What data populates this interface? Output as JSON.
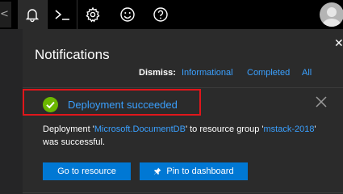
{
  "topbar": {
    "left_stub_glyph": "<",
    "icons": [
      "bell-icon",
      "cloud-shell-icon",
      "gear-icon",
      "smiley-icon",
      "help-icon"
    ],
    "avatar": "user-avatar"
  },
  "panel": {
    "title": "Notifications",
    "close_glyph": "✕",
    "dismiss": {
      "label": "Dismiss:",
      "informational": "Informational",
      "completed": "Completed",
      "all": "All"
    }
  },
  "notification": {
    "title": "Deployment succeeded",
    "body_prefix": "Deployment '",
    "resource": "Microsoft.DocumentDB",
    "body_mid": "' to resource group '",
    "group": "mstack-2018",
    "body_suffix": "' was successful.",
    "go_button": "Go to resource",
    "pin_button": "Pin to dashboard"
  },
  "colors": {
    "accent": "#0078d4",
    "link": "#3aa0ff",
    "success": "#6bb700",
    "highlight": "#e0161b"
  }
}
